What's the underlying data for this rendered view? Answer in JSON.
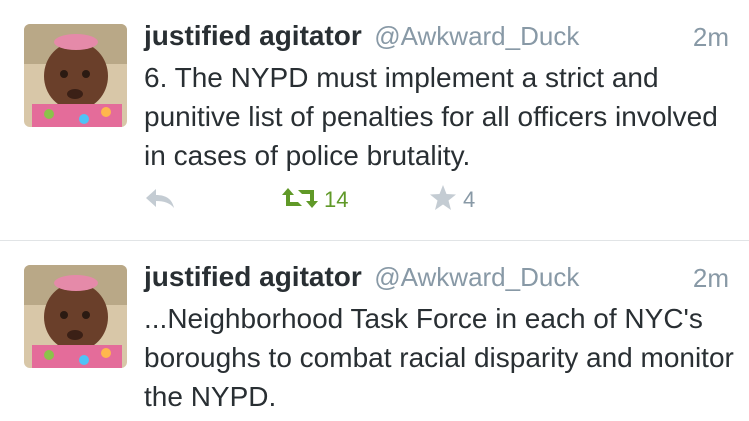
{
  "tweets": [
    {
      "author_name": "justified agitator",
      "handle": "@Awkward_Duck",
      "time": "2m",
      "text": "6. The NYPD must implement a strict and punitive list of penalties for all officers involved in cases of police brutality.",
      "retweet_count": "14",
      "favorite_count": "4",
      "icons": {
        "reply": "reply-icon",
        "retweet": "retweet-icon",
        "favorite": "star-icon"
      },
      "colors": {
        "retweet_active": "#609928",
        "muted": "#8899a6"
      }
    },
    {
      "author_name": "justified agitator",
      "handle": "@Awkward_Duck",
      "time": "2m",
      "text": "...Neighborhood Task Force in each of NYC's boroughs to combat racial disparity and monitor the NYPD."
    }
  ]
}
